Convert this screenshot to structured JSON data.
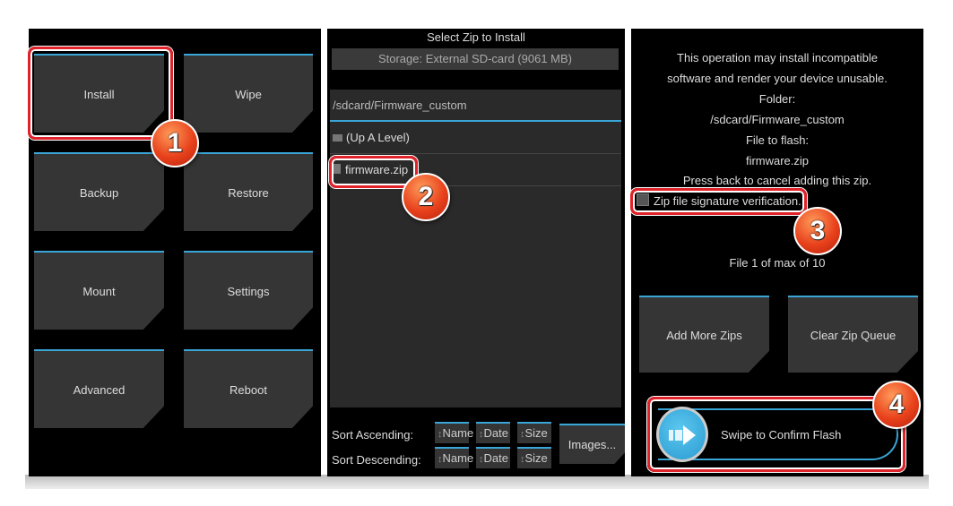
{
  "main_menu": {
    "buttons": [
      "Install",
      "Wipe",
      "Backup",
      "Restore",
      "Mount",
      "Settings",
      "Advanced",
      "Reboot"
    ]
  },
  "file_selector": {
    "title": "Select Zip to Install",
    "storage": "Storage: External SD-card (9061 MB)",
    "path": "/sdcard/Firmware_custom",
    "items": [
      {
        "label": "(Up A Level)",
        "icon": "folder-icon"
      },
      {
        "label": "firmware.zip",
        "icon": "file-icon"
      }
    ],
    "sort_ascending": "Sort Ascending:",
    "sort_descending": "Sort Descending:",
    "sort_options": [
      "Name",
      "Date",
      "Size"
    ],
    "images_button": "Images..."
  },
  "confirm": {
    "lines": [
      "This operation may install incompatible",
      "software and render your device unusable.",
      "Folder:",
      "/sdcard/Firmware_custom",
      "File to flash:",
      "firmware.zip",
      "Press back to cancel adding this zip."
    ],
    "checkbox_label": "Zip file signature verification.",
    "checkbox_checked": false,
    "file_count": "File 1 of max of 10",
    "add_more": "Add More Zips",
    "clear_queue": "Clear Zip Queue",
    "swipe": "Swipe to Confirm Flash"
  },
  "badges": [
    "1",
    "2",
    "3",
    "4"
  ],
  "colors": {
    "accent": "#3aa6d8",
    "highlight": "#e0222a",
    "badge": "#e8421c"
  }
}
